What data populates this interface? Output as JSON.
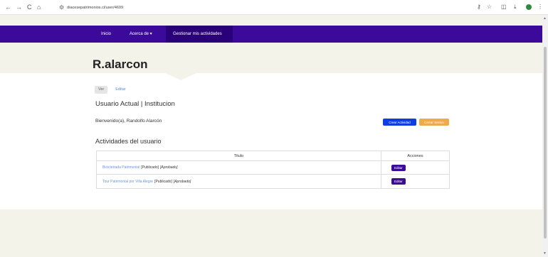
{
  "browser": {
    "url": "diacesepatrimonios.cl/user/4699",
    "nav_back": "←",
    "nav_forward": "→",
    "nav_reload": "C",
    "nav_home": "⌂"
  },
  "nav": {
    "items": [
      {
        "label": "Inicio"
      },
      {
        "label": "Acerca de ▾"
      },
      {
        "label": "Gestionar mis actividades"
      }
    ]
  },
  "profile": {
    "name": "R.alarcon"
  },
  "tabs": {
    "ver": "Ver",
    "editar": "Editar"
  },
  "section_title": "Usuario Actual | Institucion",
  "welcome": "Bienvenido(a), Randolfo Alarcón",
  "buttons": {
    "crear": "Crear Actividad",
    "cerrar": "Cerrar Sesion"
  },
  "activities": {
    "title": "Actividades del usuario",
    "headers": [
      "Titulo",
      "Acciones"
    ],
    "rows": [
      {
        "title": "Bicicletrada Patrimonial",
        "status": "[Publicado]",
        "approval": "[Aprobado]",
        "action": "Editar"
      },
      {
        "title": "Tour Patrimonial por Villa Alegre",
        "status": "[Publicado]",
        "approval": "[Aprobado]",
        "action": "Editar"
      }
    ]
  },
  "colors": {
    "nav": "#3b0a9a",
    "primary": "#0d3fe0",
    "warning": "#f0a94c",
    "hero_bg": "#f3f3ea"
  }
}
